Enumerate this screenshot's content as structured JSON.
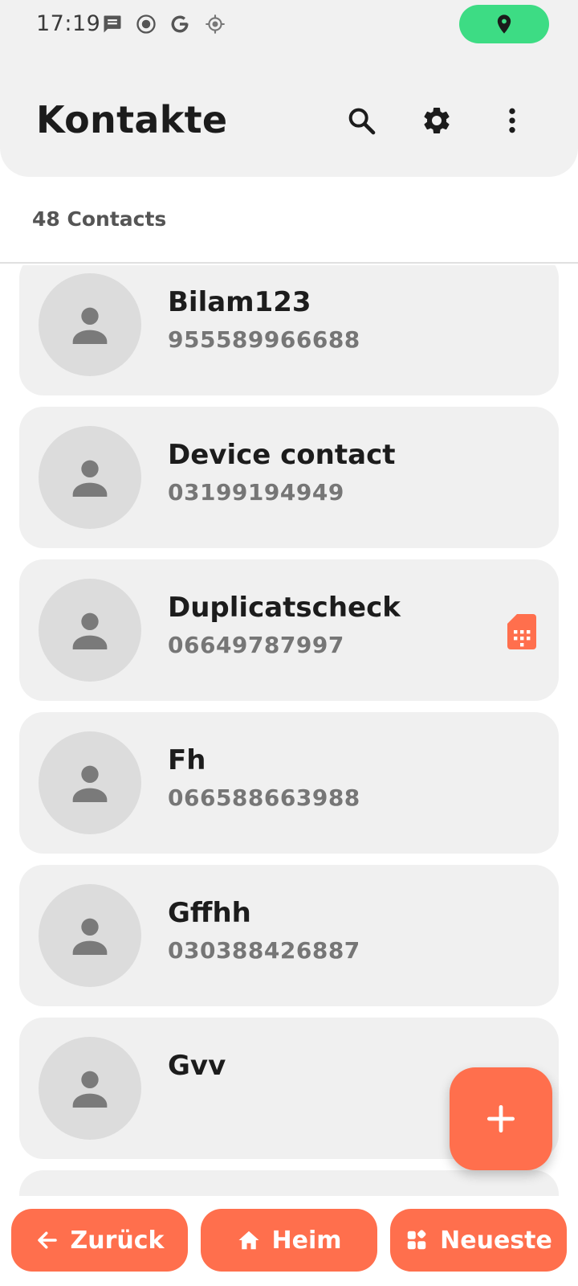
{
  "status_bar": {
    "time": "17:19",
    "icons": [
      "message-icon",
      "record-icon",
      "google-icon",
      "location-target-icon"
    ],
    "location_pill_color": "#3ddc84"
  },
  "header": {
    "title": "Kontakte",
    "actions": [
      "search-icon",
      "gear-icon",
      "more-vert-icon"
    ]
  },
  "contacts_count": "48 Contacts",
  "contacts": [
    {
      "name": "Bilam123",
      "phone": "955589966688",
      "sim": false
    },
    {
      "name": "Device contact",
      "phone": "03199194949",
      "sim": false
    },
    {
      "name": "Duplicatscheck",
      "phone": "06649787997",
      "sim": true
    },
    {
      "name": "Fh",
      "phone": "066588663988",
      "sim": false
    },
    {
      "name": "Gffhh",
      "phone": "030388426887",
      "sim": false
    },
    {
      "name": "Gvv",
      "phone": "",
      "sim": false
    }
  ],
  "fab": {
    "icon": "plus-icon"
  },
  "bottom_nav": {
    "back_label": "Zurück",
    "home_label": "Heim",
    "recent_label": "Neueste"
  },
  "colors": {
    "accent": "#ff6f4d",
    "card_bg": "#f0f0f0",
    "avatar_bg": "#dcdcdc",
    "header_bg": "#f1f1f1"
  }
}
